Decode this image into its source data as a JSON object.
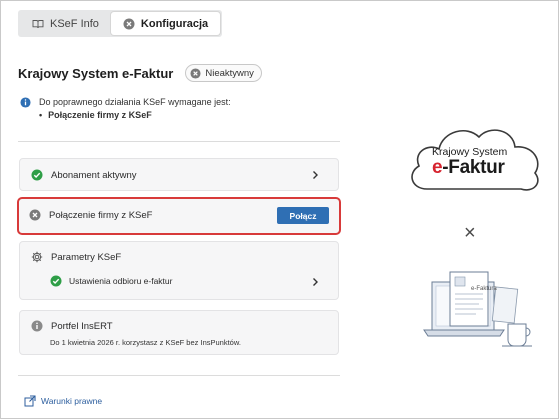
{
  "tabs": [
    {
      "label": "KSeF Info",
      "icon": "book-icon",
      "active": false
    },
    {
      "label": "Konfiguracja",
      "icon": "close-circle-icon",
      "active": true
    }
  ],
  "header": {
    "title": "Krajowy System e-Faktur",
    "status": "Nieaktywny"
  },
  "info": {
    "text": "Do poprawnego działania KSeF wymagane jest:",
    "requirement": "Połączenie firmy z KSeF"
  },
  "cards": {
    "subscription": {
      "label": "Abonament aktywny"
    },
    "connection": {
      "label": "Połączenie firmy z KSeF",
      "button": "Połącz"
    },
    "params": {
      "label": "Parametry KSeF",
      "sub_label": "Ustawienia odbioru e-faktur"
    },
    "portfel": {
      "label": "Portfel InsERT",
      "text": "Do 1 kwietnia 2026 r. korzystasz z KSeF bez InsPunktów."
    }
  },
  "footer": {
    "terms": "Warunki prawne"
  },
  "illustration": {
    "logo_line1": "Krajowy System",
    "logo_e": "e",
    "logo_rest": "-Faktur",
    "times_symbol": "×",
    "doc_label": "e-Faktura"
  },
  "colors": {
    "accent": "#2f6fb4",
    "success": "#2e9e47",
    "inactive": "#7a7a7a",
    "highlight": "#d83a3a",
    "brand_red": "#d6232f"
  }
}
